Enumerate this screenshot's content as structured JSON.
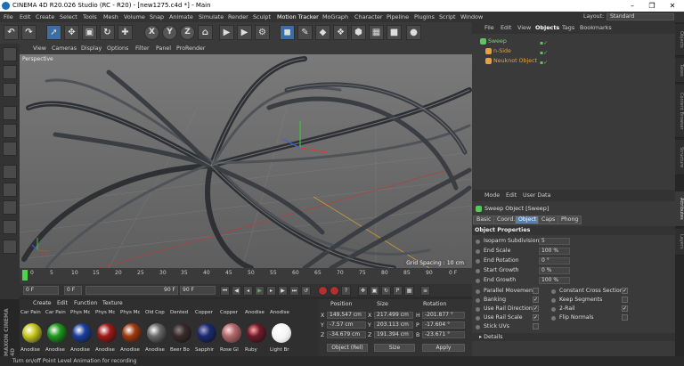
{
  "window": {
    "title": "CINEMA 4D R20.026 Studio (RC - R20) - [new1275.c4d *] - Main",
    "minimize": "–",
    "maximize": "❐",
    "close": "✕"
  },
  "menubar": {
    "items": [
      "File",
      "Edit",
      "Create",
      "Select",
      "Tools",
      "Mesh",
      "Volume",
      "Snap",
      "Animate",
      "Simulate",
      "Render",
      "Sculpt",
      "Motion Tracker",
      "MoGraph",
      "Character",
      "Pipeline",
      "Plugins",
      "Script",
      "Window"
    ],
    "layout_label": "Layout:",
    "layout_value": "Standard"
  },
  "toolbar": {
    "axis_x": "X",
    "axis_y": "Y",
    "axis_z": "Z",
    "undo": "↶"
  },
  "viewport": {
    "menu": [
      "View",
      "Cameras",
      "Display",
      "Options",
      "Filter",
      "Panel",
      "ProRender"
    ],
    "label": "Perspective",
    "grid_spacing": "Grid Spacing : 10 cm"
  },
  "timeline": {
    "ticks": [
      "0",
      "5",
      "10",
      "15",
      "20",
      "25",
      "30",
      "35",
      "40",
      "45",
      "50",
      "55",
      "60",
      "65",
      "70",
      "75",
      "80",
      "85",
      "90"
    ],
    "end_marker": "0 F"
  },
  "playback": {
    "current_frame": "0 F",
    "start_frame": "0 F",
    "end_field": "90 F",
    "end_frame": "90 F"
  },
  "materials": {
    "sidebar_text": "MAXON CINEMA 4D",
    "menu": [
      "Create",
      "Edit",
      "Function",
      "Texture"
    ],
    "top_labels": [
      "Car Pain",
      "Car Pain",
      "Phys Mc",
      "Phys Mc",
      "Phys Mc",
      "Old Cop",
      "Dented",
      "Copper",
      "Copper",
      "Anodise",
      "Anodise"
    ],
    "items": [
      {
        "name": "Anodise",
        "color": "#c8c81a"
      },
      {
        "name": "Anodise",
        "color": "#1e9a1e"
      },
      {
        "name": "Anodise",
        "color": "#1a3fa0"
      },
      {
        "name": "Anodise",
        "color": "#a01a1a"
      },
      {
        "name": "Anodise",
        "color": "#a03a10"
      },
      {
        "name": "Anodise",
        "color": "#6a6a6a"
      },
      {
        "name": "Beer Bo",
        "color": "#3a2a2a"
      },
      {
        "name": "Sapphir",
        "color": "#1a2a70"
      },
      {
        "name": "Rose Gl",
        "color": "#b06a6a"
      },
      {
        "name": "Ruby",
        "color": "#701a2a"
      },
      {
        "name": "Light Br",
        "color": "#f4f4f4"
      }
    ]
  },
  "coordinates": {
    "header_position": "Position",
    "header_size": "Size",
    "header_rotation": "Rotation",
    "rows": [
      {
        "axis": "X",
        "pos": "149.547 cm",
        "size": "217.499 cm",
        "rot_axis": "H",
        "rot": "-201.877 °"
      },
      {
        "axis": "Y",
        "pos": "-7.57 cm",
        "size": "203.113 cm",
        "rot_axis": "P",
        "rot": "-17.604 °"
      },
      {
        "axis": "Z",
        "pos": "-34.679 cm",
        "size": "191.394 cm",
        "rot_axis": "B",
        "rot": "-23.671 °"
      }
    ],
    "mode_select": "Object (Rel)",
    "size_select": "Size",
    "apply": "Apply"
  },
  "objects": {
    "menu": [
      "File",
      "Edit",
      "View",
      "Objects",
      "Tags",
      "Bookmarks"
    ],
    "items": [
      {
        "name": "Sweep",
        "color": "#7fd07f",
        "icon": "#5ec45e"
      },
      {
        "name": "n-Side",
        "color": "#e8a040",
        "icon": "#e8a040"
      },
      {
        "name": "Neuknot Object",
        "color": "#e8a040",
        "icon": "#e8a040"
      }
    ]
  },
  "attributes": {
    "menu": [
      "Mode",
      "Edit",
      "User Data"
    ],
    "title": "Sweep Object [Sweep]",
    "tabs": [
      "Basic",
      "Coord.",
      "Object",
      "Caps",
      "Phong"
    ],
    "active_tab": "Object",
    "section": "Object Properties",
    "fields": [
      {
        "label": "Isoparm Subdivision",
        "value": "5"
      },
      {
        "label": "End Scale",
        "value": "100 %"
      },
      {
        "label": "End Rotation",
        "value": "0 °"
      },
      {
        "label": "Start Growth",
        "value": "0 %"
      },
      {
        "label": "End Growth",
        "value": "100 %"
      }
    ],
    "checks_left": [
      {
        "label": "Parallel Movement",
        "checked": ""
      },
      {
        "label": "Banking",
        "checked": "✓"
      },
      {
        "label": "Use Rail Direction",
        "checked": "✓"
      },
      {
        "label": "Use Rail Scale",
        "checked": "✓"
      },
      {
        "label": "Stick UVs",
        "checked": ""
      }
    ],
    "checks_right": [
      {
        "label": "Constant Cross Section",
        "checked": "✓"
      },
      {
        "label": "Keep Segments",
        "checked": ""
      },
      {
        "label": "2-Rail",
        "checked": "✓"
      },
      {
        "label": "Flip Normals",
        "checked": ""
      }
    ],
    "details": "▸ Details"
  },
  "right_tabs": [
    "Objects",
    "Takes",
    "Content Browser",
    "Structure",
    "Attributes",
    "Layers"
  ],
  "status": "Turn on/off Point Level Animation for recording"
}
